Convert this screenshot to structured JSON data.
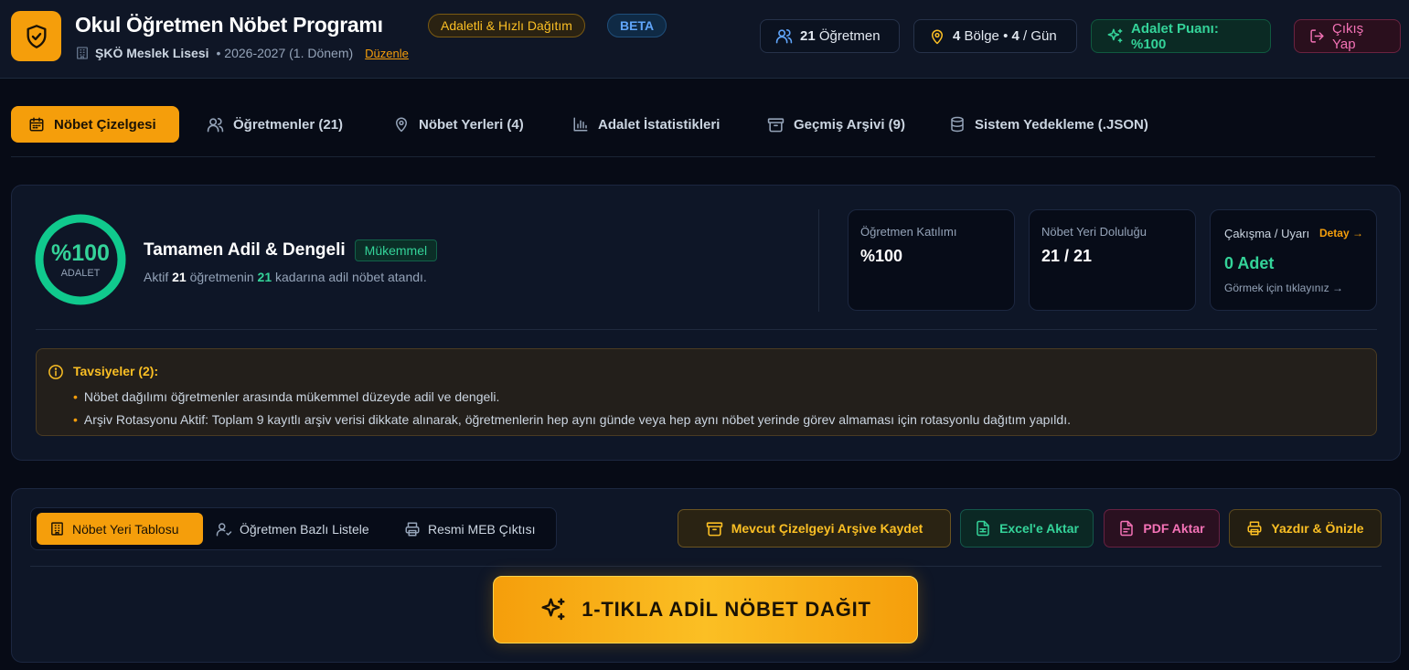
{
  "header": {
    "title": "Okul Öğretmen Nöbet Programı",
    "badge_fair": "Adaletli & Hızlı Dağıtım",
    "badge_beta": "BETA",
    "school": "ŞKÖ Meslek Lisesi",
    "term": "• 2026-2027 (1. Dönem)",
    "edit_link": "Düzenle",
    "stats": {
      "teachers_count": "21",
      "teachers_label": "Öğretmen",
      "regions_count": "4",
      "regions_label": "Bölge",
      "bullet": "•",
      "per_day_count": "4",
      "per_day_label": "/ Gün",
      "fairness_score": "Adalet Puanı: %100"
    },
    "logout": "Çıkış Yap"
  },
  "tabs": [
    {
      "label": "Nöbet Çizelgesi",
      "icon": "calendar-icon",
      "active": true
    },
    {
      "label": "Öğretmenler (21)",
      "icon": "users-icon"
    },
    {
      "label": "Nöbet Yerleri (4)",
      "icon": "map-pin-icon"
    },
    {
      "label": "Adalet İstatistikleri",
      "icon": "bar-chart-icon"
    },
    {
      "label": "Geçmiş Arşivi (9)",
      "icon": "archive-icon"
    },
    {
      "label": "Sistem Yedekleme (.JSON)",
      "icon": "database-icon"
    }
  ],
  "summary": {
    "ring_value": "%100",
    "ring_label": "ADALET",
    "ring_fraction": 1.0,
    "verdict_title": "Tamamen Adil & Dengeli",
    "verdict_badge": "Mükemmel",
    "desc_prefix": "Aktif",
    "desc_active": "21",
    "desc_middle": "öğretmenin",
    "desc_assigned": "21",
    "desc_suffix": "kadarına adil nöbet atandı."
  },
  "metrics": [
    {
      "label": "Öğretmen Katılımı",
      "value": "%100"
    },
    {
      "label": "Nöbet Yeri Doluluğu",
      "value": "21 / 21"
    },
    {
      "label": "Çakışma / Uyarı",
      "detail": "Detay →",
      "value": "0 Adet",
      "hint": "Görmek için tıklayınız →"
    }
  ],
  "advice": {
    "title": "Tavsiyeler (2):",
    "items": [
      "Nöbet dağılımı öğretmenler arasında mükemmel düzeyde adil ve dengeli.",
      "Arşiv Rotasyonu Aktif: Toplam 9 kayıtlı arşiv verisi dikkate alınarak, öğretmenlerin hep aynı günde veya hep aynı nöbet yerinde görev almaması için rotasyonlu dağıtım yapıldı."
    ]
  },
  "view_modes": [
    {
      "label": "Nöbet Yeri Tablosu",
      "icon": "building-icon",
      "active": true
    },
    {
      "label": "Öğretmen Bazlı Listele",
      "icon": "user-check-icon"
    },
    {
      "label": "Resmi MEB Çıktısı",
      "icon": "printer-icon"
    }
  ],
  "actions": {
    "archive": "Mevcut Çizelgeyi Arşive Kaydet",
    "excel": "Excel'e Aktar",
    "pdf": "PDF Aktar",
    "print": "Yazdır & Önizle"
  },
  "primary_action": "1-TIKLA ADİL NÖBET DAĞIT",
  "colors": {
    "accent": "#f59e0b",
    "success": "#34d399",
    "danger": "#f472b6",
    "info": "#60a5fa",
    "background": "#070b16",
    "panel": "#0e1627"
  }
}
